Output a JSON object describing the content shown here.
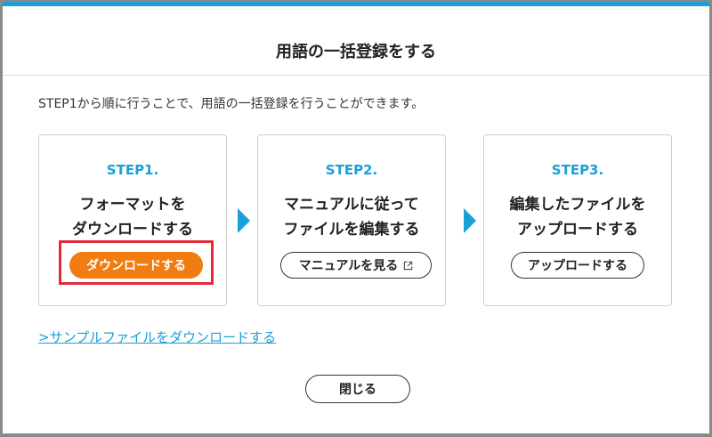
{
  "dialog": {
    "title": "用語の一括登録をする",
    "description": "STEP1から順に行うことで、用語の一括登録を行うことができます。",
    "accent_color": "#1aa0d8",
    "primary_color": "#f07c12",
    "highlight_color": "#e02a3a"
  },
  "steps": [
    {
      "label": "STEP1.",
      "line1": "フォーマットを",
      "line2": "ダウンロードする",
      "button_label": "ダウンロードする"
    },
    {
      "label": "STEP2.",
      "line1": "マニュアルに従って",
      "line2": "ファイルを編集する",
      "button_label": "マニュアルを見る",
      "button_icon": "external-link-icon"
    },
    {
      "label": "STEP3.",
      "line1": "編集したファイルを",
      "line2": "アップロードする",
      "button_label": "アップロードする"
    }
  ],
  "sample_link": ">サンプルファイルをダウンロードする",
  "close_label": "閉じる"
}
